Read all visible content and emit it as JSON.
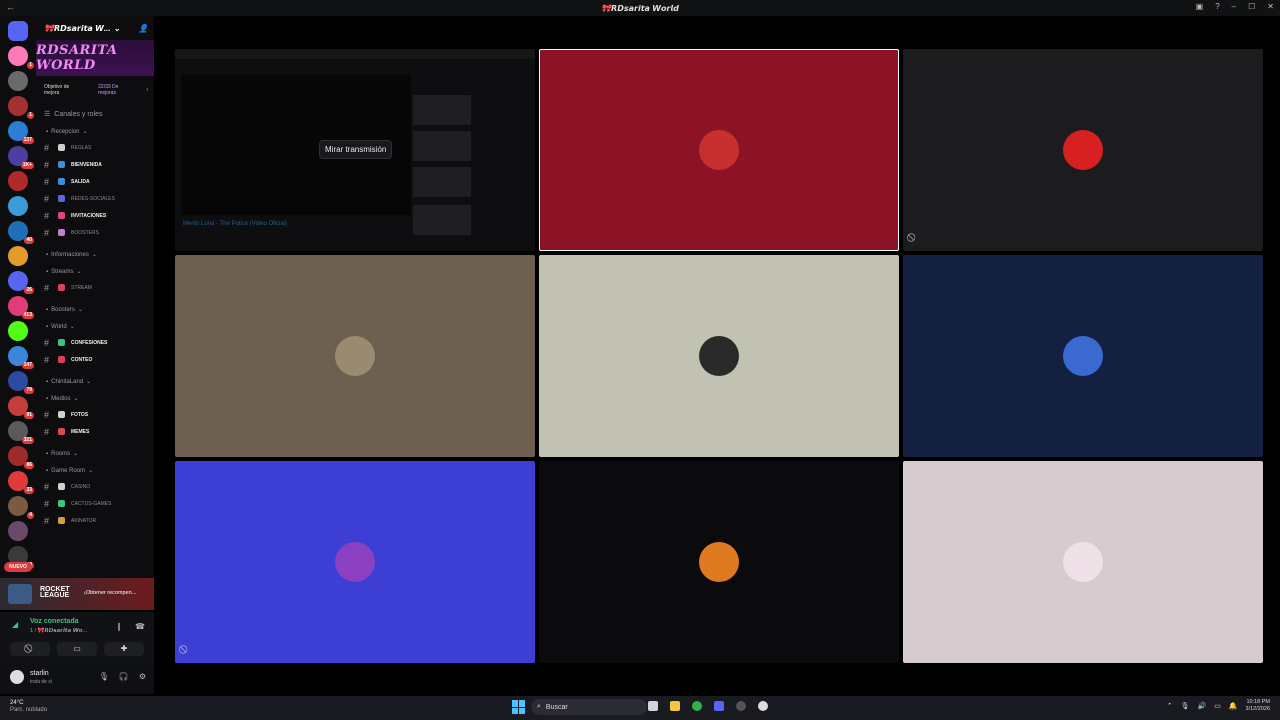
{
  "window": {
    "title": "🎀𝙍𝘿𝙨𝙖𝙧𝙞𝙩𝙖 𝙒𝙤𝙧𝙡𝙙"
  },
  "rail": {
    "servers": [
      {
        "color": "#ff7ab8",
        "badge": "1"
      },
      {
        "color": "#6a6a6a",
        "badge": ""
      },
      {
        "color": "#a43030",
        "badge": "1"
      },
      {
        "color": "#2a7fd4",
        "badge": "137"
      },
      {
        "color": "#4c3fa0",
        "badge": "1K+"
      },
      {
        "color": "#b02a2a",
        "badge": ""
      },
      {
        "color": "#3b9bd8",
        "badge": ""
      },
      {
        "color": "#1d6fb8",
        "badge": "40"
      },
      {
        "color": "#e39b2a",
        "badge": ""
      },
      {
        "color": "#5865f2",
        "badge": "26"
      },
      {
        "color": "#e23b7a",
        "badge": "413"
      },
      {
        "color": "#53fc18",
        "badge": ""
      },
      {
        "color": "#3a87d9",
        "badge": "147"
      },
      {
        "color": "#2a4ba0",
        "badge": "79"
      },
      {
        "color": "#c43e3e",
        "badge": "91"
      },
      {
        "color": "#5a5a5a",
        "badge": "321"
      },
      {
        "color": "#a02a2a",
        "badge": "86"
      },
      {
        "color": "#e03b3b",
        "badge": "33"
      },
      {
        "color": "#7a5a40",
        "badge": "4"
      },
      {
        "color": "#6a4a6a",
        "badge": ""
      },
      {
        "color": "#3a3a3a",
        "badge": "289"
      }
    ],
    "new_label": "NUEVO"
  },
  "sidebar": {
    "server_name": "🎀𝙍𝘿𝙨𝙖𝙧𝙞𝙩𝙖 𝙒...",
    "banner_text": "RDSARITA WORLD",
    "boost_goal": "Objetivo de mejora",
    "boost_count": "22/33 De mejoras",
    "roles_label": "Canales y roles",
    "sections": [
      {
        "category": "Recepcion",
        "channels": [
          {
            "name": "reglas",
            "bold": false,
            "icon": "#d0d0d0"
          },
          {
            "name": "bienvenida",
            "bold": true,
            "icon": "#3a8fd8"
          },
          {
            "name": "salida",
            "bold": true,
            "icon": "#3a8fd8"
          },
          {
            "name": "redes-sociales",
            "bold": false,
            "icon": "#5a6ad8"
          },
          {
            "name": "invitaciones",
            "bold": true,
            "icon": "#e0447a"
          },
          {
            "name": "boosters",
            "bold": false,
            "icon": "#c080d0"
          }
        ]
      },
      {
        "category": "Informaciones",
        "channels": []
      },
      {
        "category": "Streams",
        "channels": [
          {
            "name": "stream",
            "bold": false,
            "icon": "#e04060"
          }
        ]
      },
      {
        "category": "Boosters",
        "channels": []
      },
      {
        "category": "World",
        "channels": [
          {
            "name": "confesiones",
            "bold": true,
            "icon": "#3ac57e"
          },
          {
            "name": "conteo",
            "bold": true,
            "icon": "#e03b5a"
          }
        ]
      },
      {
        "category": "ChinitaLand",
        "channels": []
      },
      {
        "category": "Medios",
        "channels": [
          {
            "name": "fotos",
            "bold": true,
            "icon": "#d0d0d0"
          },
          {
            "name": "memes",
            "bold": true,
            "icon": "#e04848"
          }
        ]
      },
      {
        "category": "Rooms",
        "channels": []
      },
      {
        "category": "Game Room",
        "channels": [
          {
            "name": "casino",
            "bold": false,
            "icon": "#d0d0d0"
          },
          {
            "name": "cactus-games",
            "bold": false,
            "icon": "#3ac57e"
          },
          {
            "name": "akinator",
            "bold": false,
            "icon": "#d0a040"
          }
        ]
      }
    ]
  },
  "game_promo": {
    "name": "ROCKET LEAGUE",
    "cta": "¡Obtener recompen..."
  },
  "voice": {
    "status": "Voz conectada",
    "channel": "1 / 🎀𝙍𝘿𝙨𝙖𝙧𝙞𝙩𝙖 𝙒𝙤..."
  },
  "user": {
    "name": "starlin",
    "status": "trata de si"
  },
  "stream_tile": {
    "watch_label": "Mirar transmisión",
    "video_caption": "Merlin Luna - The Police (Video Oficial)"
  },
  "tiles": [
    {
      "bg": "#8c1325",
      "avatar": "#c83030",
      "highlight": true
    },
    {
      "bg": "#1c1c1f",
      "avatar": "#d82020",
      "highlight": false
    },
    {
      "bg": "#6e6050",
      "avatar": "#9a8a70",
      "highlight": false
    },
    {
      "bg": "#c1c2b2",
      "avatar": "#2a2a2a",
      "highlight": false
    },
    {
      "bg": "#14203f",
      "avatar": "#3a6ad0",
      "highlight": false
    },
    {
      "bg": "#3d3ed4",
      "avatar": "#8a40c0",
      "highlight": false
    },
    {
      "bg": "#0b0b0e",
      "avatar": "#e07a20",
      "highlight": false
    },
    {
      "bg": "#d6cbcf",
      "avatar": "#f0e0e8",
      "highlight": false
    }
  ],
  "taskbar": {
    "temp": "24°C",
    "weather": "Parc. nublado",
    "search_label": "Buscar",
    "time": "10:18 PM",
    "date": "3/12/2026"
  }
}
